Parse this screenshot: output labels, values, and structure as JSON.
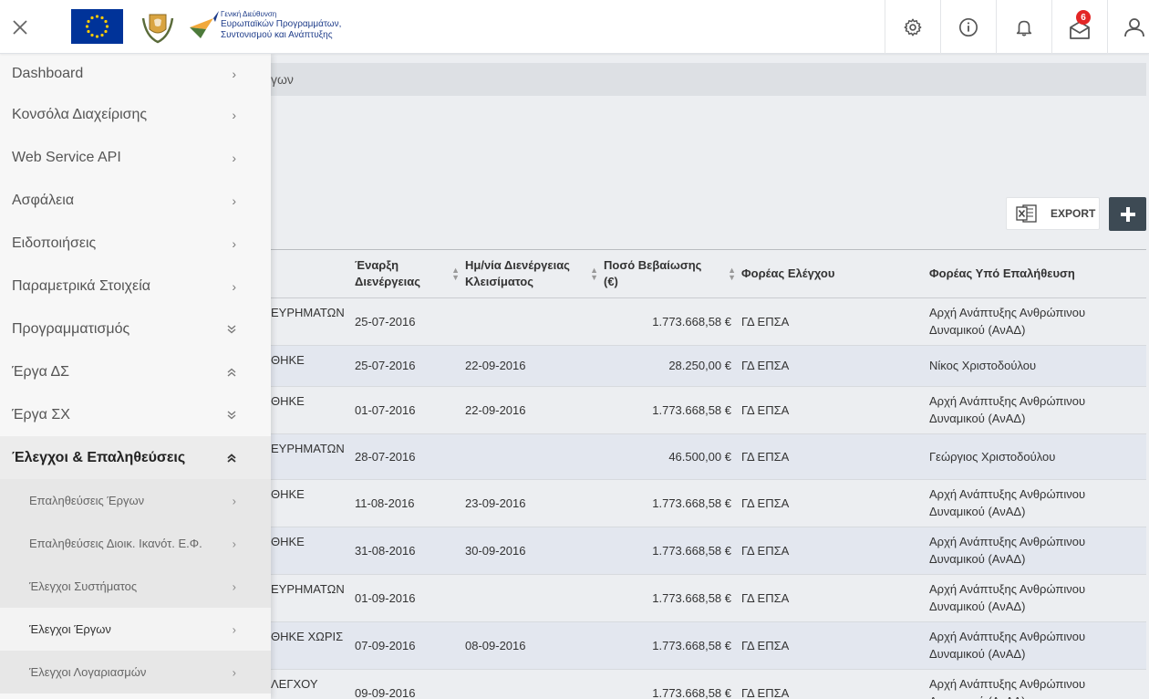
{
  "header": {
    "logo_line1": "Γενική Διεύθυνση",
    "logo_line2": "Ευρωπαϊκών Προγραμμάτων,",
    "logo_line3": "Συντονισμού και Ανάπτυξης",
    "notifications_badge": "6"
  },
  "sidebar": {
    "items": [
      {
        "label": "Dashboard",
        "chevron": "›"
      },
      {
        "label": "Κονσόλα Διαχείρισης",
        "chevron": "›"
      },
      {
        "label": "Web Service API",
        "chevron": "›"
      },
      {
        "label": "Ασφάλεια",
        "chevron": "›"
      },
      {
        "label": "Ειδοποιήσεις",
        "chevron": "›"
      },
      {
        "label": "Παραμετρικά Στοιχεία",
        "chevron": "›"
      },
      {
        "label": "Προγραμματισμός",
        "chevron": "⌄"
      },
      {
        "label": "Έργα ΔΣ",
        "chevron": "⌃"
      },
      {
        "label": "Έργα ΣΧ",
        "chevron": "⌄"
      },
      {
        "label": "Έλεγχοι & Επαληθεύσεις",
        "chevron": "⌃"
      }
    ],
    "subitems": [
      {
        "label": "Επαληθεύσεις Έργων",
        "chevron": "›"
      },
      {
        "label": "Επαληθεύσεις Διοικ. Ικανότ. Ε.Φ.",
        "chevron": "›"
      },
      {
        "label": "Έλεγχοι Συστήματος",
        "chevron": "›"
      },
      {
        "label": "Έλεγχοι Έργων",
        "chevron": "›"
      },
      {
        "label": "Έλεγχοι Λογαριασμών",
        "chevron": "›"
      }
    ]
  },
  "breadcrumb": "γων",
  "toolbar": {
    "export_label": "EXPORT",
    "add_label": "+"
  },
  "table": {
    "columns": [
      "",
      "Έναρξη Διενέργειας",
      "Ημ/νία Διενέργειας Κλεισίματος",
      "Ποσό Βεβαίωσης (€)",
      "Φορέας Ελέγχου",
      "Φορέας Υπό Επαλήθευση"
    ],
    "rows": [
      {
        "status": "ΕΥΡΗΜΑΤΩΝ",
        "start": "25-07-2016",
        "close": "",
        "amount": "1.773.668,58 €",
        "auditor": "ΓΔ ΕΠΣΑ",
        "audited": "Αρχή Ανάπτυξης Ανθρώπινου Δυναμικού (ΑνΑΔ)"
      },
      {
        "status": "ΘΗΚΕ",
        "start": "25-07-2016",
        "close": "22-09-2016",
        "amount": "28.250,00 €",
        "auditor": "ΓΔ ΕΠΣΑ",
        "audited": "Νίκος Χριστοδούλου"
      },
      {
        "status": "ΘΗΚΕ",
        "start": "01-07-2016",
        "close": "22-09-2016",
        "amount": "1.773.668,58 €",
        "auditor": "ΓΔ ΕΠΣΑ",
        "audited": "Αρχή Ανάπτυξης Ανθρώπινου Δυναμικού (ΑνΑΔ)"
      },
      {
        "status": "ΕΥΡΗΜΑΤΩΝ",
        "start": "28-07-2016",
        "close": "",
        "amount": "46.500,00 €",
        "auditor": "ΓΔ ΕΠΣΑ",
        "audited": "Γεώργιος Χριστοδούλου"
      },
      {
        "status": "ΘΗΚΕ",
        "start": "11-08-2016",
        "close": "23-09-2016",
        "amount": "1.773.668,58 €",
        "auditor": "ΓΔ ΕΠΣΑ",
        "audited": "Αρχή Ανάπτυξης Ανθρώπινου Δυναμικού (ΑνΑΔ)"
      },
      {
        "status": "ΘΗΚΕ",
        "start": "31-08-2016",
        "close": "30-09-2016",
        "amount": "1.773.668,58 €",
        "auditor": "ΓΔ ΕΠΣΑ",
        "audited": "Αρχή Ανάπτυξης Ανθρώπινου Δυναμικού (ΑνΑΔ)"
      },
      {
        "status": "ΕΥΡΗΜΑΤΩΝ",
        "start": "01-09-2016",
        "close": "",
        "amount": "1.773.668,58 €",
        "auditor": "ΓΔ ΕΠΣΑ",
        "audited": "Αρχή Ανάπτυξης Ανθρώπινου Δυναμικού (ΑνΑΔ)"
      },
      {
        "status": "ΘΗΚΕ ΧΩΡΙΣ",
        "start": "07-09-2016",
        "close": "08-09-2016",
        "amount": "1.773.668,58 €",
        "auditor": "ΓΔ ΕΠΣΑ",
        "audited": "Αρχή Ανάπτυξης Ανθρώπινου Δυναμικού (ΑνΑΔ)"
      },
      {
        "status": "ΛΕΓΧΟΥ",
        "start": "09-09-2016",
        "close": "",
        "amount": "1.773.668,58 €",
        "auditor": "ΓΔ ΕΠΣΑ",
        "audited": "Αρχή Ανάπτυξης Ανθρώπινου Δυναμικού (ΑνΑΔ)"
      }
    ]
  },
  "colors": {
    "header_bg": "#ffffff",
    "sidebar_bg": "#f7f7f7",
    "content_bg": "#eceef1",
    "badge": "#e32626",
    "add_button": "#3d4a54",
    "eu_flag": "#003399"
  },
  "icons": [
    "close-icon",
    "gear-icon",
    "info-icon",
    "bell-icon",
    "mail-icon",
    "user-icon",
    "excel-icon",
    "plus-icon"
  ]
}
